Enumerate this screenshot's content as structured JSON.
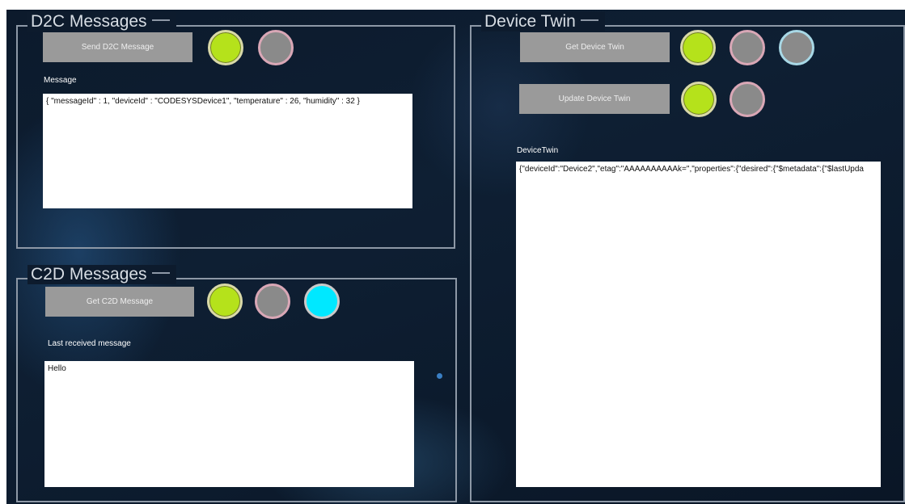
{
  "d2c": {
    "title": "D2C Messages",
    "send_button": "Send D2C Message",
    "message_label": "Message",
    "message_value": "{ \"messageId\" : 1, \"deviceId\" : \"CODESYSDevice1\", \"temperature\" : 26, \"humidity\" : 32 }"
  },
  "c2d": {
    "title": "C2D Messages",
    "get_button": "Get C2D Message",
    "last_label": "Last received message",
    "last_value": "Hello"
  },
  "twin": {
    "title": "Device Twin",
    "get_button": "Get Device Twin",
    "update_button": "Update Device Twin",
    "twin_label": "DeviceTwin",
    "twin_value": "{\"deviceId\":\"Device2\",\"etag\":\"AAAAAAAAAAk=\",\"properties\":{\"desired\":{\"$metadata\":{\"$lastUpda"
  },
  "colors": {
    "led_on": "#b5e21b",
    "led_off": "#8a8a8a",
    "led_active_cyan": "#00e8ff"
  }
}
